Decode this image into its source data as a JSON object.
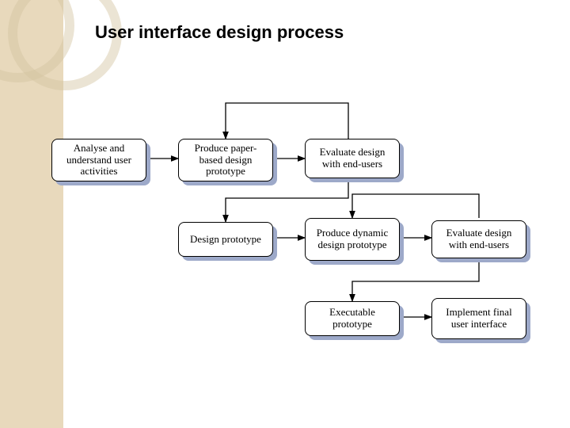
{
  "title": "User interface design process",
  "nodes": {
    "analyse": {
      "label": "Analyse and understand user activities"
    },
    "paper": {
      "label": "Produce paper-based design prototype"
    },
    "eval1": {
      "label": "Evaluate design with end-users"
    },
    "design": {
      "label": "Design prototype"
    },
    "dynamic": {
      "label": "Produce dynamic design prototype"
    },
    "eval2": {
      "label": "Evaluate design with end-users"
    },
    "executable": {
      "label": "Executable prototype"
    },
    "implement": {
      "label": "Implement final user interface"
    }
  },
  "edges": [
    {
      "from": "analyse",
      "to": "paper"
    },
    {
      "from": "paper",
      "to": "eval1"
    },
    {
      "from": "eval1",
      "to": "paper",
      "note": "feedback loop"
    },
    {
      "from": "eval1",
      "to": "design"
    },
    {
      "from": "design",
      "to": "dynamic"
    },
    {
      "from": "dynamic",
      "to": "eval2"
    },
    {
      "from": "eval2",
      "to": "dynamic",
      "note": "feedback loop"
    },
    {
      "from": "eval2",
      "to": "executable"
    },
    {
      "from": "executable",
      "to": "implement"
    }
  ]
}
